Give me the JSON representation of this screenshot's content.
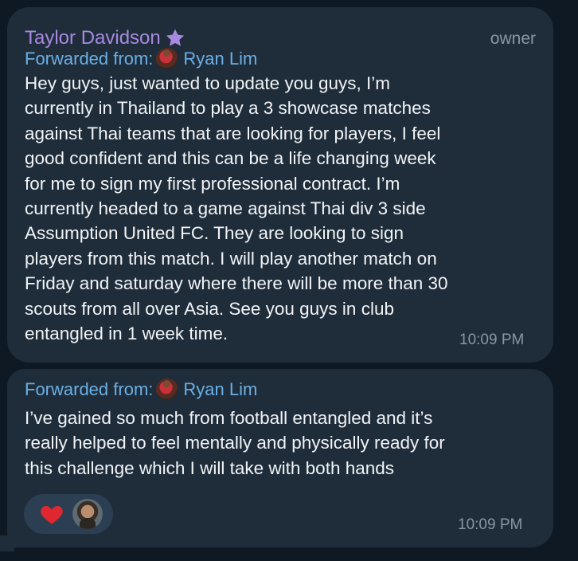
{
  "messages": [
    {
      "sender": "Taylor Davidson",
      "role_tag": "owner",
      "forwarded_label": "Forwarded from:",
      "forwarded_name": "Ryan Lim",
      "text": "Hey guys, just wanted to update you guys, I’m\ncurrently in Thailand to play a 3 showcase matches\nagainst Thai teams that are looking for players, I feel\ngood confident and this can be a life changing week\nfor me to sign my first professional contract. I’m\ncurrently headed to a game against Thai div 3 side\nAssumption United FC. They are looking to sign\nplayers from this match. I will play another match on\nFriday and saturday where there will be more than 30\nscouts from all over Asia. See you guys in club\nentangled in 1 week time.",
      "time": "10:09 PM"
    },
    {
      "forwarded_label": "Forwarded from:",
      "forwarded_name": "Ryan Lim",
      "text": "I’ve gained so much from football entangled and it’s\nreally helped to feel mentally and physically ready for\nthis challenge which I will take with both hands",
      "reactions": [
        {
          "icon": "heart-icon",
          "color": "#e0262f",
          "count": 1
        }
      ],
      "time": "10:09 PM"
    }
  ],
  "colors": {
    "background": "#0f1923",
    "bubble": "#1f2d3b",
    "sender_name": "#a889e0",
    "forward_link": "#6ab0e6",
    "text": "#f2f4f6",
    "meta": "#8796a5",
    "reaction_pill": "#2b3e52"
  },
  "icons": {
    "sender_badge": "star-icon",
    "forward_avatar": "avatar",
    "reaction": "heart-icon"
  }
}
